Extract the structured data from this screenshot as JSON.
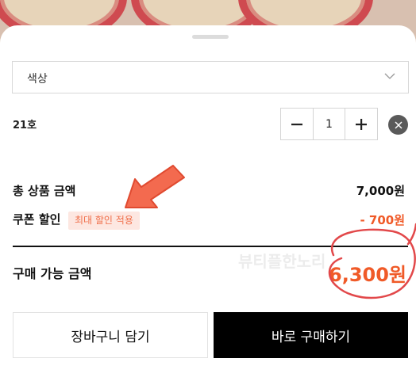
{
  "option_select": {
    "label": "색상"
  },
  "option_item": {
    "name": "21호",
    "quantity": "1"
  },
  "summary": {
    "total_label": "총 상품 금액",
    "total_value": "7,000원",
    "coupon_label": "쿠폰 할인",
    "coupon_tag": "최대 할인 적용",
    "coupon_value": "- 700원",
    "final_label": "구매 가능 금액",
    "final_value": "6,300원"
  },
  "buttons": {
    "cart": "장바구니 담기",
    "buy": "바로 구매하기"
  },
  "watermark": "뷰티플한노리",
  "colors": {
    "accent": "#f05a28",
    "buy_bg": "#000000",
    "tag_bg": "#fde7e1"
  }
}
